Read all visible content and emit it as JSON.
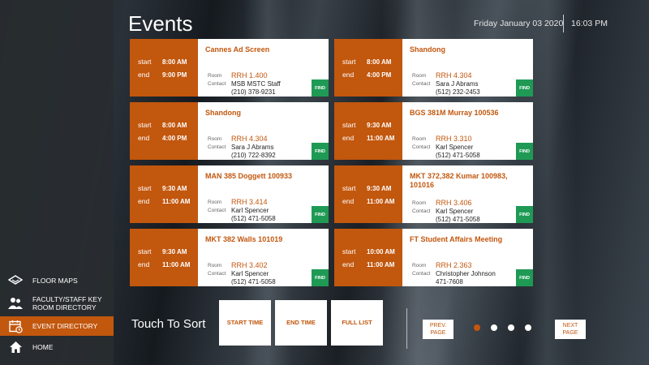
{
  "header": {
    "title": "Events",
    "date": "Friday January 03 2020",
    "time": "16:03 PM"
  },
  "sidebar": {
    "items": [
      {
        "label": "FLOOR MAPS",
        "icon": "floor-map-icon"
      },
      {
        "label": "FACULTY/STAFF KEY ROOM DIRECTORY",
        "icon": "people-icon"
      },
      {
        "label": "EVENT DIRECTORY",
        "icon": "calendar-icon",
        "active": true
      },
      {
        "label": "HOME",
        "icon": "home-icon"
      }
    ]
  },
  "card_labels": {
    "start": "start",
    "end": "end",
    "room": "Room",
    "contact": "Contact",
    "find": "FIND"
  },
  "events": [
    {
      "title": "Cannes Ad Screen",
      "start": "8:00 AM",
      "end": "9:00 PM",
      "room": "RRH 1.400",
      "contact_name": "MSB MSTC Staff",
      "contact_phone": "(210) 378-9231"
    },
    {
      "title": "Shandong",
      "start": "8:00 AM",
      "end": "4:00 PM",
      "room": "RRH 4.304",
      "contact_name": "Sara J Abrams",
      "contact_phone": "(512) 232-2453"
    },
    {
      "title": "Shandong",
      "start": "8:00 AM",
      "end": "4:00 PM",
      "room": "RRH 4.304",
      "contact_name": "Sara J Abrams",
      "contact_phone": "(210) 722-8392"
    },
    {
      "title": "BGS 381M Murray 100536",
      "start": "9:30 AM",
      "end": "11:00 AM",
      "room": "RRH 3.310",
      "contact_name": "Karl Spencer",
      "contact_phone": "(512) 471-5058"
    },
    {
      "title": "MAN 385 Doggett 100933",
      "start": "9:30 AM",
      "end": "11:00 AM",
      "room": "RRH 3.414",
      "contact_name": "Karl Spencer",
      "contact_phone": "(512) 471-5058"
    },
    {
      "title": "MKT 372,382 Kumar 100983, 101016",
      "start": "9:30 AM",
      "end": "11:00 AM",
      "room": "RRH 3.406",
      "contact_name": "Karl Spencer",
      "contact_phone": "(512) 471-5058"
    },
    {
      "title": "MKT 382 Walls 101019",
      "start": "9:30 AM",
      "end": "11:00 AM",
      "room": "RRH 3.402",
      "contact_name": "Karl Spencer",
      "contact_phone": "(512) 471-5058"
    },
    {
      "title": "FT Student Affairs Meeting",
      "start": "10:00 AM",
      "end": "11:00 AM",
      "room": "RRH 2.363",
      "contact_name": "Christopher Johnson",
      "contact_phone": "471-7608"
    }
  ],
  "footer": {
    "sort_label": "Touch To Sort",
    "sort_buttons": [
      "START TIME",
      "END TIME",
      "FULL LIST"
    ],
    "prev": "PREV. PAGE",
    "next": "NEXT PAGE",
    "pages": 4,
    "current_page": 1
  },
  "colors": {
    "accent": "#c2570e",
    "find": "#1f9a55",
    "sidebar": "#282c30"
  }
}
